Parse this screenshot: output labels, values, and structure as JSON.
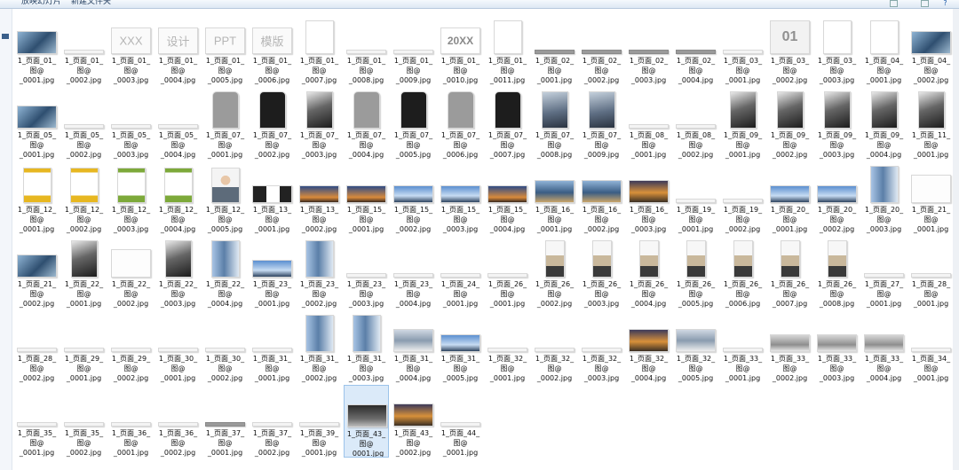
{
  "toolbar": {
    "share_label": "放映幻灯片",
    "new_folder_label": "新建文件夹"
  },
  "files": [
    {
      "name": "1_页面_01_\n图@\n_0001.jpg",
      "thumb": "city"
    },
    {
      "name": "1_页面_01_\n图@\n_0002.jpg",
      "thumb": "strip"
    },
    {
      "name": "1_页面_01_\n图@\n_0003.jpg",
      "thumb": "word",
      "text": "XXX"
    },
    {
      "name": "1_页面_01_\n图@\n_0004.jpg",
      "thumb": "word",
      "text": "设计"
    },
    {
      "name": "1_页面_01_\n图@\n_0005.jpg",
      "thumb": "word",
      "text": "PPT"
    },
    {
      "name": "1_页面_01_\n图@\n_0006.jpg",
      "thumb": "word",
      "text": "模版"
    },
    {
      "name": "1_页面_01_\n图@\n_0007.jpg",
      "thumb": "blank"
    },
    {
      "name": "1_页面_01_\n图@\n_0008.jpg",
      "thumb": "strip"
    },
    {
      "name": "1_页面_01_\n图@\n_0009.jpg",
      "thumb": "strip"
    },
    {
      "name": "1_页面_01_\n图@\n_0010.jpg",
      "thumb": "20xx",
      "text": "20XX"
    },
    {
      "name": "1_页面_01_\n图@\n_0011.jpg",
      "thumb": "blank"
    },
    {
      "name": "1_页面_02_\n图@\n_0001.jpg",
      "thumb": "gstrip"
    },
    {
      "name": "1_页面_02_\n图@\n_0002.jpg",
      "thumb": "gstrip"
    },
    {
      "name": "1_页面_02_\n图@\n_0003.jpg",
      "thumb": "gstrip"
    },
    {
      "name": "1_页面_02_\n图@\n_0004.jpg",
      "thumb": "gstrip"
    },
    {
      "name": "1_页面_03_\n图@\n_0001.jpg",
      "thumb": "strip"
    },
    {
      "name": "1_页面_03_\n图@\n_0002.jpg",
      "thumb": "01",
      "text": "01"
    },
    {
      "name": "1_页面_03_\n图@\n_0003.jpg",
      "thumb": "blank"
    },
    {
      "name": "1_页面_04_\n图@\n_0001.jpg",
      "thumb": "blank"
    },
    {
      "name": "1_页面_04_\n图@\n_0002.jpg",
      "thumb": "city"
    },
    {
      "name": "1_页面_05_\n图@\n_0001.jpg",
      "thumb": "city"
    },
    {
      "name": "1_页面_05_\n图@\n_0002.jpg",
      "thumb": "strip"
    },
    {
      "name": "1_页面_05_\n图@\n_0003.jpg",
      "thumb": "strip"
    },
    {
      "name": "1_页面_05_\n图@\n_0004.jpg",
      "thumb": "strip"
    },
    {
      "name": "1_页面_07_\n图@\n_0001.jpg",
      "thumb": "gray"
    },
    {
      "name": "1_页面_07_\n图@\n_0002.jpg",
      "thumb": "black"
    },
    {
      "name": "1_页面_07_\n图@\n_0003.jpg",
      "thumb": "bw"
    },
    {
      "name": "1_页面_07_\n图@\n_0004.jpg",
      "thumb": "gray"
    },
    {
      "name": "1_页面_07_\n图@\n_0005.jpg",
      "thumb": "black"
    },
    {
      "name": "1_页面_07_\n图@\n_0006.jpg",
      "thumb": "gray"
    },
    {
      "name": "1_页面_07_\n图@\n_0007.jpg",
      "thumb": "black"
    },
    {
      "name": "1_页面_07_\n图@\n_0008.jpg",
      "thumb": "cityt"
    },
    {
      "name": "1_页面_07_\n图@\n_0009.jpg",
      "thumb": "cityt"
    },
    {
      "name": "1_页面_08_\n图@\n_0001.jpg",
      "thumb": "strip"
    },
    {
      "name": "1_页面_08_\n图@\n_0002.jpg",
      "thumb": "strip"
    },
    {
      "name": "1_页面_09_\n图@\n_0001.jpg",
      "thumb": "bw"
    },
    {
      "name": "1_页面_09_\n图@\n_0002.jpg",
      "thumb": "bw"
    },
    {
      "name": "1_页面_09_\n图@\n_0003.jpg",
      "thumb": "bw"
    },
    {
      "name": "1_页面_09_\n图@\n_0004.jpg",
      "thumb": "bw"
    },
    {
      "name": "1_页面_11_\n图@\n_0001.jpg",
      "thumb": "bw"
    },
    {
      "name": "1_页面_12_\n图@\n_0001.jpg",
      "thumb": "yellow"
    },
    {
      "name": "1_页面_12_\n图@\n_0002.jpg",
      "thumb": "yellow"
    },
    {
      "name": "1_页面_12_\n图@\n_0003.jpg",
      "thumb": "green"
    },
    {
      "name": "1_页面_12_\n图@\n_0004.jpg",
      "thumb": "green"
    },
    {
      "name": "1_页面_12_\n图@\n_0005.jpg",
      "thumb": "people"
    },
    {
      "name": "1_页面_13_\n图@\n_0001.jpg",
      "thumb": "screen"
    },
    {
      "name": "1_页面_13_\n图@\n_0002.jpg",
      "thumb": "dusk"
    },
    {
      "name": "1_页面_15_\n图@\n_0001.jpg",
      "thumb": "dusk"
    },
    {
      "name": "1_页面_15_\n图@\n_0002.jpg",
      "thumb": "sky"
    },
    {
      "name": "1_页面_15_\n图@\n_0003.jpg",
      "thumb": "sky"
    },
    {
      "name": "1_页面_15_\n图@\n_0004.jpg",
      "thumb": "dusk"
    },
    {
      "name": "1_页面_16_\n图@\n_0001.jpg",
      "thumb": "photo"
    },
    {
      "name": "1_页面_16_\n图@\n_0002.jpg",
      "thumb": "photo"
    },
    {
      "name": "1_页面_16_\n图@\n_0003.jpg",
      "thumb": "sunset"
    },
    {
      "name": "1_页面_19_\n图@\n_0001.jpg",
      "thumb": "strip"
    },
    {
      "name": "1_页面_19_\n图@\n_0002.jpg",
      "thumb": "strip"
    },
    {
      "name": "1_页面_20_\n图@\n_0001.jpg",
      "thumb": "sky"
    },
    {
      "name": "1_页面_20_\n图@\n_0002.jpg",
      "thumb": "sky"
    },
    {
      "name": "1_页面_20_\n图@\n_0003.jpg",
      "thumb": "bldg"
    },
    {
      "name": "1_页面_21_\n图@\n_0001.jpg",
      "thumb": "white"
    },
    {
      "name": "1_页面_21_\n图@\n_0002.jpg",
      "thumb": "city"
    },
    {
      "name": "1_页面_22_\n图@\n_0001.jpg",
      "thumb": "bw"
    },
    {
      "name": "1_页面_22_\n图@\n_0002.jpg",
      "thumb": "white"
    },
    {
      "name": "1_页面_22_\n图@\n_0003.jpg",
      "thumb": "bw"
    },
    {
      "name": "1_页面_22_\n图@\n_0004.jpg",
      "thumb": "bldg"
    },
    {
      "name": "1_页面_23_\n图@\n_0001.jpg",
      "thumb": "sky"
    },
    {
      "name": "1_页面_23_\n图@\n_0002.jpg",
      "thumb": "bldg"
    },
    {
      "name": "1_页面_23_\n图@\n_0003.jpg",
      "thumb": "strip"
    },
    {
      "name": "1_页面_23_\n图@\n_0004.jpg",
      "thumb": "strip"
    },
    {
      "name": "1_页面_24_\n图@\n_0001.jpg",
      "thumb": "strip"
    },
    {
      "name": "1_页面_26_\n图@\n_0001.jpg",
      "thumb": "strip"
    },
    {
      "name": "1_页面_26_\n图@\n_0002.jpg",
      "thumb": "perch"
    },
    {
      "name": "1_页面_26_\n图@\n_0003.jpg",
      "thumb": "perch"
    },
    {
      "name": "1_页面_26_\n图@\n_0004.jpg",
      "thumb": "perch"
    },
    {
      "name": "1_页面_26_\n图@\n_0005.jpg",
      "thumb": "perch"
    },
    {
      "name": "1_页面_26_\n图@\n_0006.jpg",
      "thumb": "perch"
    },
    {
      "name": "1_页面_26_\n图@\n_0007.jpg",
      "thumb": "perch"
    },
    {
      "name": "1_页面_26_\n图@\n_0008.jpg",
      "thumb": "perch"
    },
    {
      "name": "1_页面_27_\n图@\n_0001.jpg",
      "thumb": "strip"
    },
    {
      "name": "1_页面_28_\n图@\n_0001.jpg",
      "thumb": "strip"
    },
    {
      "name": "1_页面_28_\n图@\n_0002.jpg",
      "thumb": "strip"
    },
    {
      "name": "1_页面_29_\n图@\n_0001.jpg",
      "thumb": "strip"
    },
    {
      "name": "1_页面_29_\n图@\n_0002.jpg",
      "thumb": "strip"
    },
    {
      "name": "1_页面_30_\n图@\n_0001.jpg",
      "thumb": "strip"
    },
    {
      "name": "1_页面_30_\n图@\n_0002.jpg",
      "thumb": "strip"
    },
    {
      "name": "1_页面_31_\n图@\n_0001.jpg",
      "thumb": "strip"
    },
    {
      "name": "1_页面_31_\n图@\n_0002.jpg",
      "thumb": "bldg"
    },
    {
      "name": "1_页面_31_\n图@\n_0003.jpg",
      "thumb": "bldg"
    },
    {
      "name": "1_页面_31_\n图@\n_0004.jpg",
      "thumb": "office"
    },
    {
      "name": "1_页面_31_\n图@\n_0005.jpg",
      "thumb": "sky"
    },
    {
      "name": "1_页面_32_\n图@\n_0001.jpg",
      "thumb": "strip"
    },
    {
      "name": "1_页面_32_\n图@\n_0002.jpg",
      "thumb": "strip"
    },
    {
      "name": "1_页面_32_\n图@\n_0003.jpg",
      "thumb": "strip"
    },
    {
      "name": "1_页面_32_\n图@\n_0004.jpg",
      "thumb": "sunset"
    },
    {
      "name": "1_页面_32_\n图@\n_0005.jpg",
      "thumb": "office"
    },
    {
      "name": "1_页面_33_\n图@\n_0001.jpg",
      "thumb": "strip"
    },
    {
      "name": "1_页面_33_\n图@\n_0002.jpg",
      "thumb": "lapt"
    },
    {
      "name": "1_页面_33_\n图@\n_0003.jpg",
      "thumb": "lapt"
    },
    {
      "name": "1_页面_33_\n图@\n_0004.jpg",
      "thumb": "lapt"
    },
    {
      "name": "1_页面_34_\n图@\n_0001.jpg",
      "thumb": "strip"
    },
    {
      "name": "1_页面_35_\n图@\n_0001.jpg",
      "thumb": "strip"
    },
    {
      "name": "1_页面_35_\n图@\n_0002.jpg",
      "thumb": "strip"
    },
    {
      "name": "1_页面_36_\n图@\n_0001.jpg",
      "thumb": "strip"
    },
    {
      "name": "1_页面_36_\n图@\n_0002.jpg",
      "thumb": "strip"
    },
    {
      "name": "1_页面_37_\n图@\n_0001.jpg",
      "thumb": "gstrip"
    },
    {
      "name": "1_页面_37_\n图@\n_0002.jpg",
      "thumb": "strip"
    },
    {
      "name": "1_页面_39_\n图@\n_0001.jpg",
      "thumb": "strip"
    },
    {
      "name": "1_页面_43_\n图@\n_0001.jpg",
      "thumb": "lapdk",
      "selected": true
    },
    {
      "name": "1_页面_43_\n图@\n_0002.jpg",
      "thumb": "sunset"
    },
    {
      "name": "1_页面_44_\n图@\n_0001.jpg",
      "thumb": "strip"
    }
  ]
}
